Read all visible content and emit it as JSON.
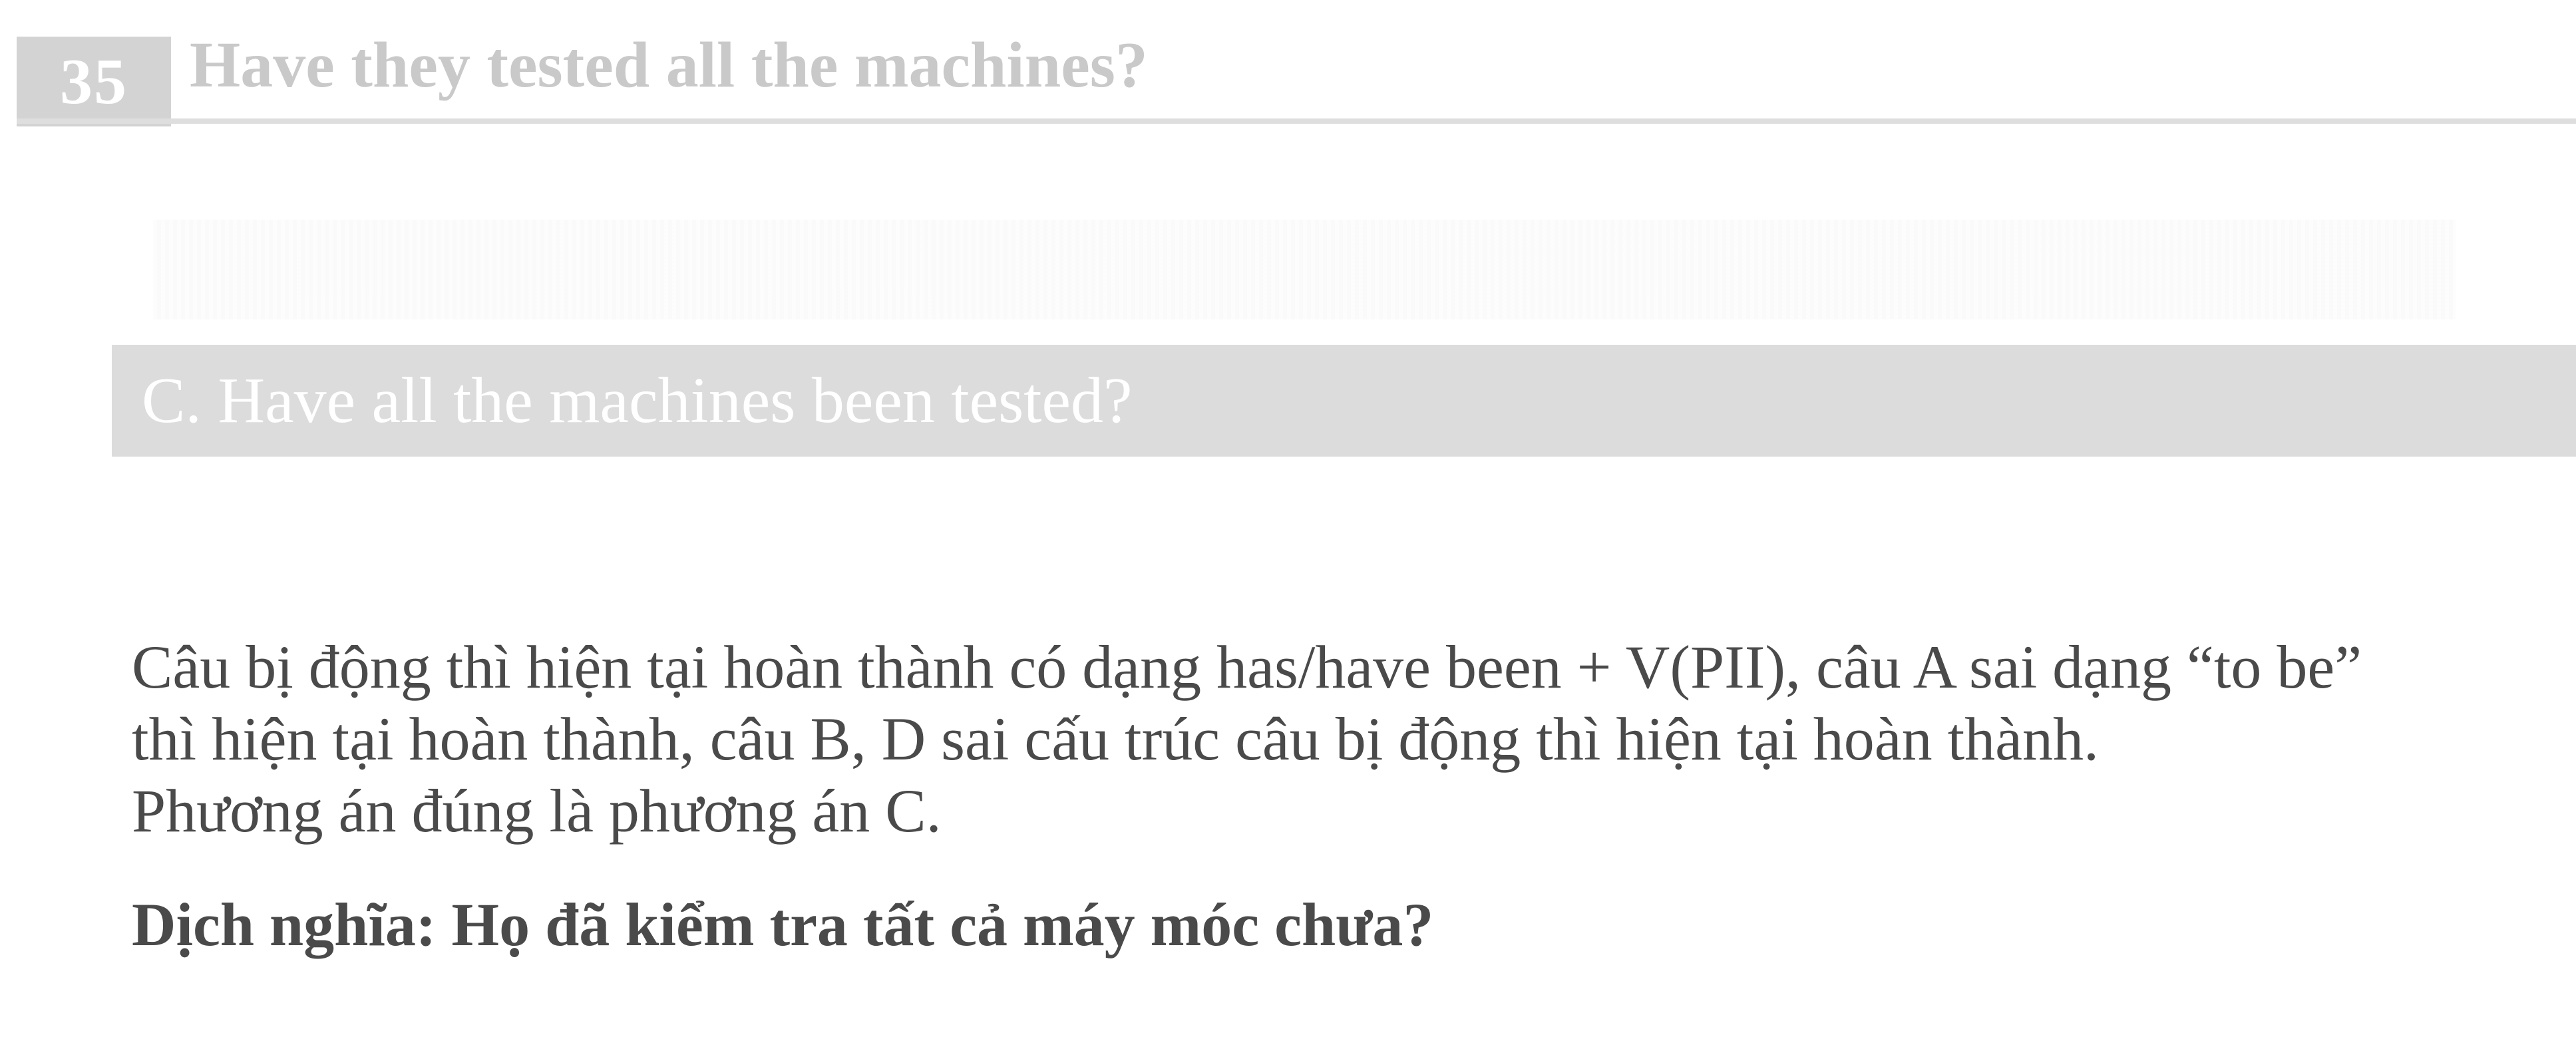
{
  "question": {
    "number": "35",
    "text": "Have they tested all the machines?"
  },
  "answer": {
    "text": "C. Have all the machines been tested?"
  },
  "explanation": {
    "lines": [
      "Câu bị động thì hiện tại hoàn thành có dạng has/have been + V(PII), câu A sai dạng “to be”",
      "thì hiện tại hoàn thành, câu B, D sai cấu trúc câu bị động thì hiện tại hoàn thành.",
      "Phương án đúng là phương án C."
    ],
    "translation": "Dịch nghĩa: Họ đã kiểm tra tất cả máy móc chưa?"
  }
}
